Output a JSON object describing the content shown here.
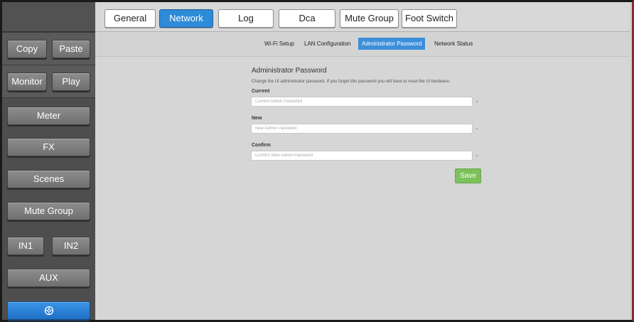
{
  "top_tabs": [
    {
      "label": "General"
    },
    {
      "label": "Network"
    },
    {
      "label": "Log"
    },
    {
      "label": "Dca"
    },
    {
      "label": "Mute Group"
    },
    {
      "label": "Foot Switch"
    }
  ],
  "sidebar": {
    "copy": "Copy",
    "paste": "Paste",
    "monitor": "Monitor",
    "play": "Play",
    "meter": "Meter",
    "fx": "FX",
    "scenes": "Scenes",
    "mute_group": "Mute Group",
    "in1": "IN1",
    "in2": "IN2",
    "aux": "AUX",
    "bottom_icon": "settings-wheel-icon"
  },
  "sub_tabs": [
    {
      "label": "Wi-Fi Setup"
    },
    {
      "label": "LAN Configuration"
    },
    {
      "label": "Administrator Password"
    },
    {
      "label": "Network Status"
    }
  ],
  "panel": {
    "title": "Administrator Password",
    "description": "Change the UI administrator password. If you forget this password you will have to reset the UI hardware.",
    "current_label": "Current",
    "current_placeholder": "Current Admin Password",
    "new_label": "New",
    "new_placeholder": "New Admin Password",
    "confirm_label": "Confirm",
    "confirm_placeholder": "Confirm New Admin Password",
    "save_label": "Save"
  },
  "colors": {
    "accent": "#2e8bd8",
    "save": "#7cc15a",
    "sidebar": "#4a4a4a"
  }
}
